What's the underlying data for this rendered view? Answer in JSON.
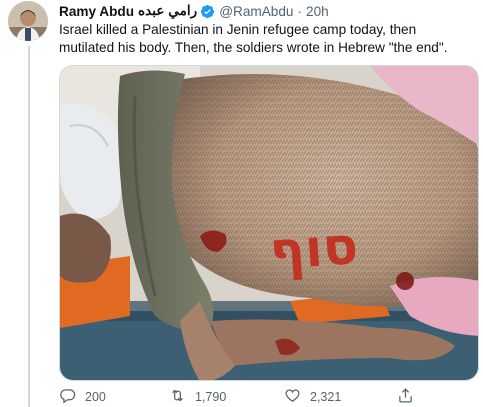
{
  "tweet": {
    "author": {
      "display_name": "Ramy Abdu",
      "display_name_arabic": "رامي عبده",
      "verified_icon": "verified-badge-icon",
      "handle": "@RamAbdu",
      "separator": "·",
      "time": "20h"
    },
    "text": "Israel killed a Palestinian in Jenin refugee camp today, then mutilated his body. Then, the soldiers wrote in Hebrew \"the end\".",
    "media": {
      "handwriting_shown": "סוף"
    },
    "actions": {
      "reply_count": "200",
      "retweet_count": "1,790",
      "like_count": "2,321",
      "reply_icon": "reply-icon",
      "retweet_icon": "retweet-icon",
      "like_icon": "heart-icon",
      "share_icon": "share-icon"
    },
    "colors": {
      "verified_blue": "#1d9bf0",
      "secondary_text": "#536471",
      "divider": "#cfd9de"
    }
  }
}
